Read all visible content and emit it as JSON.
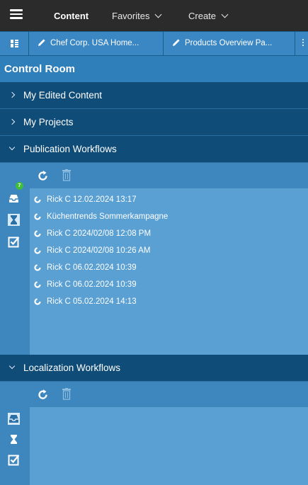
{
  "topbar": {
    "menu_icon": "hamburger-icon",
    "nav": [
      {
        "label": "Content"
      },
      {
        "label": "Favorites"
      },
      {
        "label": "Create"
      }
    ]
  },
  "tabs": [
    {
      "label": "Chef Corp. USA Home..."
    },
    {
      "label": "Products Overview Pa..."
    }
  ],
  "control_room": {
    "title": "Control Room",
    "sections": [
      {
        "label": "My Edited Content",
        "expanded": false
      },
      {
        "label": "My Projects",
        "expanded": false
      },
      {
        "label": "Publication Workflows",
        "expanded": true
      },
      {
        "label": "Localization Workflows",
        "expanded": true
      }
    ]
  },
  "publication": {
    "pending_count": "7",
    "items": [
      {
        "label": "Rick C 12.02.2024 13:17"
      },
      {
        "label": "Küchentrends Sommerkampagne"
      },
      {
        "label": "Rick C 2024/02/08 12:08 PM"
      },
      {
        "label": "Rick C 2024/02/08 10:26 AM"
      },
      {
        "label": "Rick C 06.02.2024 10:39"
      },
      {
        "label": "Rick C 06.02.2024 10:39"
      },
      {
        "label": "Rick C 05.02.2024 14:13"
      }
    ]
  },
  "colors": {
    "topbar": "#2b2b2b",
    "tab": "#3a87c4",
    "section": "#0f4c78",
    "panel": "#5aa0d3",
    "badge": "#3fbe3a"
  }
}
